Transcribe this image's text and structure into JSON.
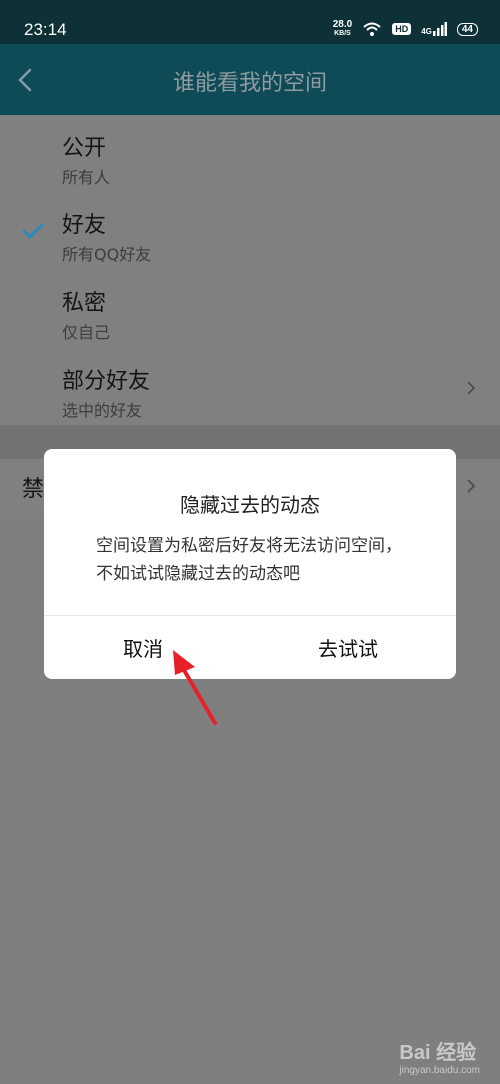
{
  "status": {
    "time": "23:14",
    "speed_value": "28.0",
    "speed_unit": "KB/S",
    "hd": "HD",
    "network": "4G",
    "battery": "44"
  },
  "header": {
    "title": "谁能看我的空间"
  },
  "options": [
    {
      "title": "公开",
      "subtitle": "所有人"
    },
    {
      "title": "好友",
      "subtitle": "所有QQ好友",
      "selected": true
    },
    {
      "title": "私密",
      "subtitle": "仅自己"
    },
    {
      "title": "部分好友",
      "subtitle": "选中的好友"
    }
  ],
  "row2": {
    "label": "禁"
  },
  "dialog": {
    "title": "隐藏过去的动态",
    "message": "空间设置为私密后好友将无法访问空间，不如试试隐藏过去的动态吧",
    "cancel": "取消",
    "confirm": "去试试"
  },
  "watermark": {
    "logo": "Bai 经验",
    "url": "jingyan.baidu.com"
  },
  "colors": {
    "accent": "#1a8fc4",
    "header_bg": "#0f4a57",
    "annotation": "#e8202a"
  }
}
